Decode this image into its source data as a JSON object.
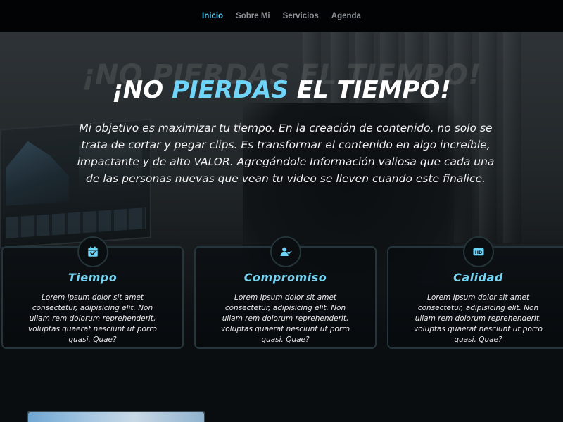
{
  "nav": {
    "items": [
      {
        "label": "Inicio",
        "active": true
      },
      {
        "label": "Sobre Mi",
        "active": false
      },
      {
        "label": "Servicios",
        "active": false
      },
      {
        "label": "Agenda",
        "active": false
      }
    ]
  },
  "hero": {
    "ghost_title": "¡NO PIERDAS EL TIEMPO!",
    "title_part1": "¡NO ",
    "title_accent": "PIERDAS",
    "title_part2": " EL TIEMPO!",
    "subtitle": "Mi objetivo es maximizar tu tiempo. En la creación de contenido, no solo se trata de cortar y pegar clips. Es transformar el contenido en algo increíble, impactante y de alto VALOR. Agregándole Información valiosa que cada una de las personas nuevas que vean tu video se lleven cuando este finalice."
  },
  "cards": [
    {
      "icon": "calendar-check-icon",
      "title": "Tiempo",
      "text": "Lorem ipsum dolor sit amet consectetur, adipisicing elit. Non ullam rem dolorum reprehenderit, voluptas quaerat nesciunt ut porro quasi. Quae?"
    },
    {
      "icon": "user-check-icon",
      "title": "Compromiso",
      "text": "Lorem ipsum dolor sit amet consectetur, adipisicing elit. Non ullam rem dolorum reprehenderit, voluptas quaerat nesciunt ut porro quasi. Quae?"
    },
    {
      "icon": "hd-icon",
      "title": "Calidad",
      "text": "Lorem ipsum dolor sit amet consectetur, adipisicing elit. Non ullam rem dolorum reprehenderit, voluptas quaerat nesciunt ut porro quasi. Quae?",
      "icon_label": "HD"
    }
  ],
  "colors": {
    "accent": "#6fd4f7",
    "nav_active": "#5fd0f5",
    "nav_inactive": "#8a8f94",
    "card_border": "#24363b"
  }
}
